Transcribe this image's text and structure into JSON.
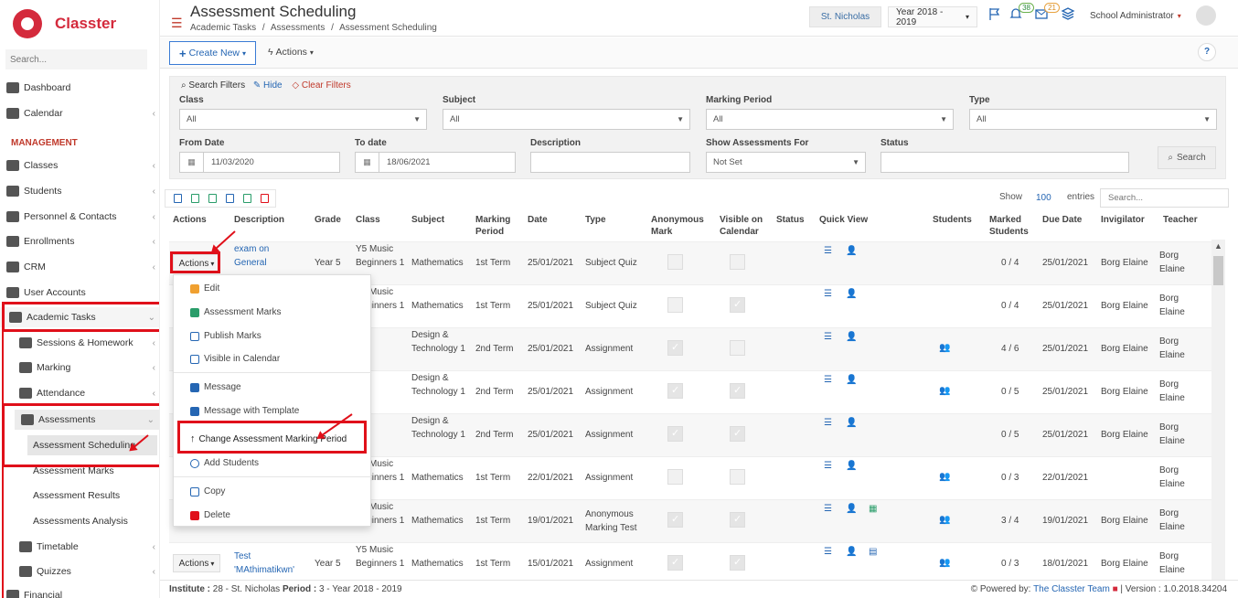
{
  "app": {
    "name": "Classter",
    "search_placeholder": "Search..."
  },
  "sidebar": {
    "section_management": "MANAGEMENT",
    "items": [
      {
        "label": "Dashboard"
      },
      {
        "label": "Calendar"
      },
      {
        "label": "Classes"
      },
      {
        "label": "Students"
      },
      {
        "label": "Personnel & Contacts"
      },
      {
        "label": "Enrollments"
      },
      {
        "label": "CRM"
      },
      {
        "label": "User Accounts"
      },
      {
        "label": "Academic Tasks"
      },
      {
        "label": "Sessions & Homework"
      },
      {
        "label": "Marking"
      },
      {
        "label": "Attendance"
      },
      {
        "label": "Assessments"
      },
      {
        "label": "Assessment Scheduling"
      },
      {
        "label": "Assessment Marks"
      },
      {
        "label": "Assessment Results"
      },
      {
        "label": "Assessments Analysis"
      },
      {
        "label": "Timetable"
      },
      {
        "label": "Quizzes"
      },
      {
        "label": "Financial"
      }
    ]
  },
  "header": {
    "title": "Assessment Scheduling",
    "breadcrumb": [
      "Academic Tasks",
      "/",
      "Assessments",
      "/",
      "Assessment Scheduling"
    ],
    "institute": "St. Nicholas",
    "year": "Year 2018 - 2019",
    "notif_count": "38",
    "msg_count": "21",
    "user": "School Administrator"
  },
  "toolbar": {
    "create_new": "Create New",
    "actions": "Actions",
    "help": "?"
  },
  "filters": {
    "title": "Search Filters",
    "hide": "Hide",
    "clear": "Clear Filters",
    "class_label": "Class",
    "class_value": "All",
    "subject_label": "Subject",
    "subject_value": "All",
    "period_label": "Marking Period",
    "period_value": "All",
    "type_label": "Type",
    "type_value": "All",
    "from_label": "From Date",
    "from_value": "11/03/2020",
    "to_label": "To date",
    "to_value": "18/06/2021",
    "desc_label": "Description",
    "show_for_label": "Show Assessments For",
    "show_for_value": "Not Set",
    "status_label": "Status",
    "search_btn": "Search"
  },
  "table": {
    "show": "Show",
    "entries_count": "100",
    "entries": "entries",
    "search_placeholder": "Search...",
    "headers": [
      "Actions",
      "Description",
      "Grade",
      "Class",
      "Subject",
      "Marking Period",
      "Date",
      "Type",
      "Anonymous Mark",
      "Visible on Calendar",
      "Status",
      "Quick View",
      "Students",
      "Marked Students",
      "Due Date",
      "Invigilator",
      "Teacher"
    ],
    "rows": [
      {
        "action": "Actions",
        "desc": "exam on General Information",
        "grade": "Year 5",
        "cls": "Y5 Music Beginners 1",
        "subject": "Mathematics",
        "period": "1st Term",
        "date": "25/01/2021",
        "type": "Subject Quiz",
        "marked": "0 / 4",
        "due": "25/01/2021",
        "invig": "Borg Elaine",
        "teacher": "Borg Elaine"
      },
      {
        "action": "",
        "desc": "",
        "grade": "",
        "cls": "Y5 Music Beginners 1",
        "subject": "Mathematics",
        "period": "1st Term",
        "date": "25/01/2021",
        "type": "Subject Quiz",
        "marked": "0 / 4",
        "due": "25/01/2021",
        "invig": "Borg Elaine",
        "teacher": "Borg Elaine"
      },
      {
        "action": "",
        "desc": "",
        "grade": "",
        "cls": "",
        "subject": "Design & Technology 1",
        "period": "2nd Term",
        "date": "25/01/2021",
        "type": "Assignment",
        "marked": "4 / 6",
        "due": "25/01/2021",
        "invig": "Borg Elaine",
        "teacher": "Borg Elaine"
      },
      {
        "action": "",
        "desc": "",
        "grade": "",
        "cls": "",
        "subject": "Design & Technology 1",
        "period": "2nd Term",
        "date": "25/01/2021",
        "type": "Assignment",
        "marked": "0 / 5",
        "due": "25/01/2021",
        "invig": "Borg Elaine",
        "teacher": "Borg Elaine"
      },
      {
        "action": "",
        "desc": "",
        "grade": "",
        "cls": "",
        "subject": "Design & Technology 1",
        "period": "2nd Term",
        "date": "25/01/2021",
        "type": "Assignment",
        "marked": "0 / 5",
        "due": "25/01/2021",
        "invig": "Borg Elaine",
        "teacher": "Borg Elaine"
      },
      {
        "action": "",
        "desc": "",
        "grade": "",
        "cls": "Y5 Music Beginners 1",
        "subject": "Mathematics",
        "period": "1st Term",
        "date": "22/01/2021",
        "type": "Assignment",
        "marked": "0 / 3",
        "due": "22/01/2021",
        "invig": "",
        "teacher": "Borg Elaine"
      },
      {
        "action": "",
        "desc": "",
        "grade": "",
        "cls": "Y5 Music Beginners 1",
        "subject": "Mathematics",
        "period": "1st Term",
        "date": "19/01/2021",
        "type": "Anonymous Marking Test",
        "marked": "3 / 4",
        "due": "19/01/2021",
        "invig": "Borg Elaine",
        "teacher": "Borg Elaine"
      },
      {
        "action": "Actions",
        "desc": "Test 'MAthimatikwn'",
        "grade": "Year 5",
        "cls": "Y5 Music Beginners 1",
        "subject": "Mathematics",
        "period": "1st Term",
        "date": "15/01/2021",
        "type": "Assignment",
        "marked": "0 / 3",
        "due": "18/01/2021",
        "invig": "Borg Elaine",
        "teacher": "Borg Elaine"
      }
    ]
  },
  "menu": {
    "items": [
      "Edit",
      "Assessment Marks",
      "Publish Marks",
      "Visible in Calendar",
      "Message",
      "Message with Template",
      "Change Assessment Marking Period",
      "Add Students",
      "Copy",
      "Delete"
    ]
  },
  "footer": {
    "institute_lbl": "Institute :",
    "institute_val": "28 - St. Nicholas",
    "period_lbl": "Period :",
    "period_val": "3 - Year 2018 - 2019",
    "powered": "Powered by:",
    "team": "The Classter Team",
    "version": "| Version : 1.0.2018.34204"
  }
}
